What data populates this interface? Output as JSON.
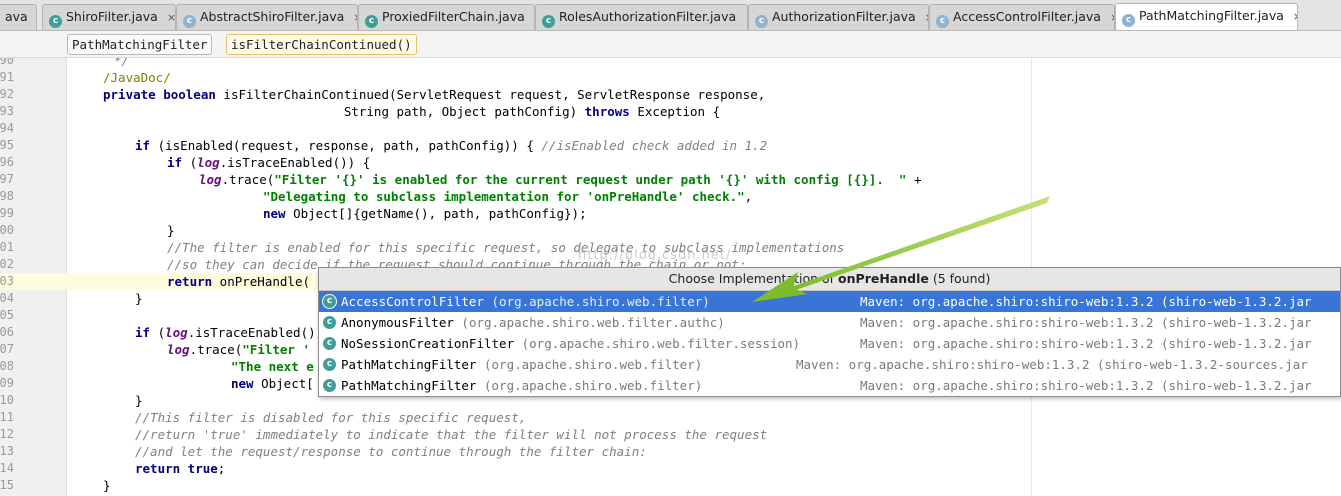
{
  "tabs": [
    {
      "label": "ava",
      "icon": "class-icon",
      "kind": "class",
      "active": false
    },
    {
      "label": "ShiroFilter.java",
      "icon": "class-icon",
      "kind": "class",
      "active": false
    },
    {
      "label": "AbstractShiroFilter.java",
      "icon": "class-icon",
      "kind": "abstract",
      "active": false
    },
    {
      "label": "ProxiedFilterChain.java",
      "icon": "class-icon",
      "kind": "class",
      "active": false
    },
    {
      "label": "RolesAuthorizationFilter.java",
      "icon": "class-icon",
      "kind": "class",
      "active": false
    },
    {
      "label": "AuthorizationFilter.java",
      "icon": "class-icon",
      "kind": "abstract",
      "active": false
    },
    {
      "label": "AccessControlFilter.java",
      "icon": "class-icon",
      "kind": "abstract",
      "active": false
    },
    {
      "label": "PathMatchingFilter.java",
      "icon": "class-icon",
      "kind": "abstract",
      "active": true
    }
  ],
  "tab_close_glyph": "×",
  "breadcrumbs": [
    "PathMatchingFilter",
    "isFilterChainContinued()"
  ],
  "line_numbers": [
    "90",
    "91",
    "92",
    "93",
    "94",
    "95",
    "96",
    "97",
    "98",
    "99",
    "100",
    "101",
    "102",
    "103",
    "104",
    "105",
    "106",
    "107",
    "108",
    "109",
    "110",
    "111",
    "112",
    "113",
    "114",
    "115"
  ],
  "code": {
    "l90": "*/",
    "l91": "/JavaDoc/",
    "l92_kw": "private boolean",
    "l92_rest": " isFilterChainContinued(ServletRequest request, ServletResponse response,",
    "l93": "                                String path, Object pathConfig) ",
    "l93_kw": "throws",
    "l93_rest": " Exception {",
    "l95_kw": "if",
    "l95_rest": " (isEnabled(request, response, path, pathConfig)) { ",
    "l95_cmt": "//isEnabled check added in 1.2",
    "l96_kw": "if",
    "l96_a": " (",
    "l96_fld": "log",
    "l96_rest": ".isTraceEnabled()) {",
    "l97_fld": "log",
    "l97_a": ".trace(",
    "l97_str": "\"Filter '{}' is enabled for the current request under path '{}' with config [{}].  \"",
    "l97_rest": " +",
    "l98_str": "\"Delegating to subclass implementation for 'onPreHandle' check.\"",
    "l98_rest": ",",
    "l99_kw": "new",
    "l99_rest": " Object[]{getName(), path, pathConfig});",
    "l100": "}",
    "l101_cmt": "//The filter is enabled for this specific request, so delegate to subclass implementations",
    "l102_cmt": "//so they can decide if the request should continue through the chain or not:",
    "l103_kw": "return",
    "l103_rest": " onPreHandle(",
    "l104": "}",
    "l106_kw": "if",
    "l106_a": " (",
    "l106_fld": "log",
    "l106_rest": ".isTraceEnabled()) {",
    "l107_fld": "log",
    "l107_a": ".trace(",
    "l107_str": "\"Filter '",
    "l108_str": "\"The next e",
    "l109_kw": "new",
    "l109_rest": " Object[",
    "l110": "}",
    "l111_cmt": "//This filter is disabled for this specific request,",
    "l112_cmt": "//return 'true' immediately to indicate that the filter will not process the request",
    "l113_cmt": "//and let the request/response to continue through the filter chain:",
    "l114_kw": "return true",
    "l114_rest": ";",
    "l115": "}"
  },
  "popup": {
    "title_prefix": "Choose Implementation of ",
    "title_method": "onPreHandle",
    "title_suffix": " (5 found)",
    "rows": [
      {
        "name": "AccessControlFilter",
        "pkg": "(org.apache.shiro.web.filter)",
        "location": "Maven: org.apache.shiro:shiro-web:1.3.2 (shiro-web-1.3.2.jar",
        "selected": true,
        "kind": "abstract"
      },
      {
        "name": "AnonymousFilter",
        "pkg": "(org.apache.shiro.web.filter.authc)",
        "location": "Maven: org.apache.shiro:shiro-web:1.3.2 (shiro-web-1.3.2.jar",
        "selected": false,
        "kind": "class"
      },
      {
        "name": "NoSessionCreationFilter",
        "pkg": "(org.apache.shiro.web.filter.session)",
        "location": "Maven: org.apache.shiro:shiro-web:1.3.2 (shiro-web-1.3.2.jar",
        "selected": false,
        "kind": "class"
      },
      {
        "name": "PathMatchingFilter",
        "pkg": "(org.apache.shiro.web.filter)",
        "location": "Maven: org.apache.shiro:shiro-web:1.3.2 (shiro-web-1.3.2-sources.jar",
        "selected": false,
        "kind": "abstract"
      },
      {
        "name": "PathMatchingFilter",
        "pkg": "(org.apache.shiro.web.filter)",
        "location": "Maven: org.apache.shiro:shiro-web:1.3.2 (shiro-web-1.3.2.jar",
        "selected": false,
        "kind": "abstract"
      }
    ]
  },
  "class_icon_glyph": "c",
  "watermark": "http://blog.csdn.net/",
  "colors": {
    "selection": "#3875d7",
    "arrow": "#8cc63f",
    "keyword": "#000080",
    "string": "#008000",
    "comment": "#808080"
  }
}
